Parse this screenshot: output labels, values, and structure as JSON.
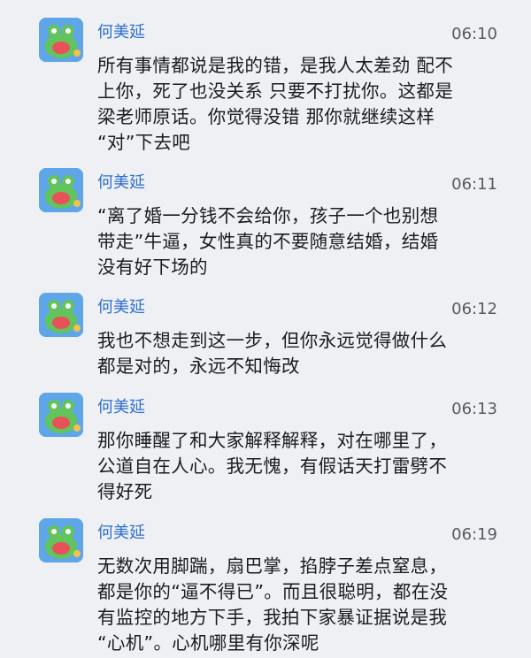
{
  "messages": [
    {
      "sender": "何美延",
      "time": "06:10",
      "text": "所有事情都说是我的错，是我人太差劲 配不\n上你，死了也没关系 只要不打扰你。这都是\n梁老师原话。你觉得没错 那你就继续这样\n“对”下去吧"
    },
    {
      "sender": "何美延",
      "time": "06:11",
      "text": "“离了婚一分钱不会给你，孩子一个也别想\n带走”牛逼，女性真的不要随意结婚，结婚\n没有好下场的"
    },
    {
      "sender": "何美延",
      "time": "06:12",
      "text": "我也不想走到这一步，但你永远觉得做什么\n都是对的，永远不知悔改"
    },
    {
      "sender": "何美延",
      "time": "06:13",
      "text": "那你睡醒了和大家解释解释，对在哪里了，\n公道自在人心。我无愧，有假话天打雷劈不\n得好死"
    },
    {
      "sender": "何美延",
      "time": "06:19",
      "text": "无数次用脚踹，扇巴掌，掐脖子差点窒息，\n都是你的“逼不得已”。而且很聪明，都在没\n有监控的地方下手，我拍下家暴证据说是我\n“心机”。心机哪里有你深呢"
    }
  ],
  "avatar": {
    "icon": "frog-avatar-icon",
    "bg": "#5fa6e8",
    "face": "#62c45a",
    "mouth": "#e8505a"
  }
}
